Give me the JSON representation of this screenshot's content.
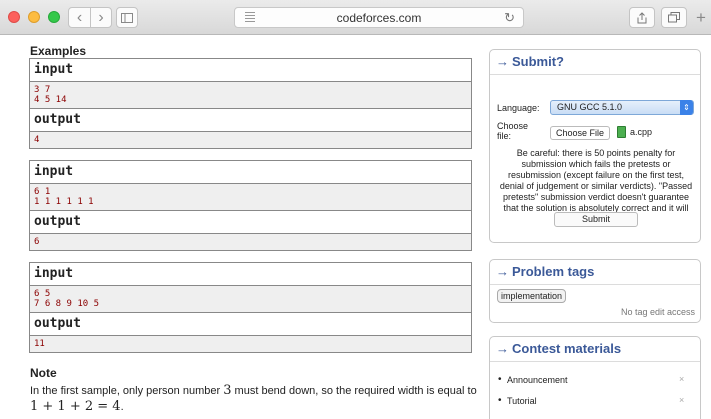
{
  "browser": {
    "url": "codeforces.com",
    "icons": [
      "close-light",
      "minimize-light",
      "zoom-light",
      "back-icon",
      "forward-icon",
      "sidebar-icon",
      "reader-icon",
      "reload-icon",
      "share-icon",
      "tabs-icon",
      "new-tab-icon"
    ],
    "back": "‹",
    "forward": "›",
    "reload": "↻",
    "newtab": "+"
  },
  "examples": {
    "title": "Examples",
    "samples": [
      {
        "input_label": "input",
        "input_lines": [
          "3 7",
          "4 5 14"
        ],
        "output_label": "output",
        "output_lines": [
          "4"
        ]
      },
      {
        "input_label": "input",
        "input_lines": [
          "6 1",
          "1 1 1 1 1 1"
        ],
        "output_label": "output",
        "output_lines": [
          "6"
        ]
      },
      {
        "input_label": "input",
        "input_lines": [
          "6 5",
          "7 6 8 9 10 5"
        ],
        "output_label": "output",
        "output_lines": [
          "11"
        ]
      }
    ]
  },
  "note": {
    "title": "Note",
    "text_before": "In the first sample, only person number ",
    "number": "3",
    "text_after": " must bend down, so the required width is equal to",
    "formula": "1 + 1 + 2 = 4",
    "formula_end": "."
  },
  "submit_box": {
    "arrow": "→",
    "title": "Submit?",
    "language_label": "Language:",
    "language_value": "GNU GCC 5.1.0",
    "choose_label": "Choose file:",
    "choose_button": "Choose File",
    "file_name": "a.cpp",
    "warning": "Be careful: there is 50 points penalty for submission which fails the pretests or resubmission (except failure on the first test, denial of judgement or similar verdicts). \"Passed pretests\" submission verdict doesn't guarantee that the solution is absolutely correct and it will pass system tests.",
    "submit_button": "Submit"
  },
  "tags_box": {
    "arrow": "→",
    "title": "Problem tags",
    "tags": [
      "implementation"
    ],
    "no_access": "No tag edit access"
  },
  "materials_box": {
    "arrow": "→",
    "title": "Contest materials",
    "items": [
      "Announcement",
      "Tutorial"
    ],
    "remove": "×"
  },
  "colors": {
    "title_blue": "#3b5998",
    "data_red": "#8b0000",
    "data_bg": "#efefef"
  }
}
